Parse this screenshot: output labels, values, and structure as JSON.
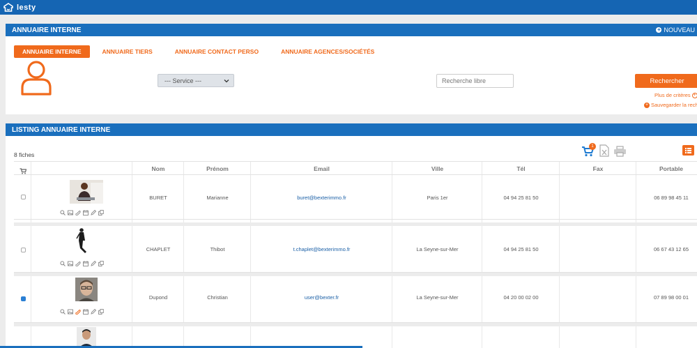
{
  "app": {
    "brand": "lesty"
  },
  "search_panel": {
    "title": "ANNUAIRE INTERNE",
    "new_label": "Nouveau",
    "tabs": [
      {
        "label": "ANNUAIRE INTERNE",
        "active": true
      },
      {
        "label": "ANNUAIRE TIERS",
        "active": false
      },
      {
        "label": "ANNUAIRE CONTACT PERSO",
        "active": false
      },
      {
        "label": "ANNUAIRE AGENCES/SOCIÉTÉS",
        "active": false
      }
    ],
    "service_value": "--- Service ---",
    "free_search_placeholder": "Recherche libre",
    "search_button": "Rechercher",
    "more_criteria": "Plus de critères",
    "save_search": "Sauvegarder la recher"
  },
  "list_panel": {
    "title": "LISTING ANNUAIRE INTERNE",
    "count": "8 fiches",
    "cart_badge": "1",
    "columns": [
      "Nom",
      "Prénom",
      "Email",
      "Ville",
      "Tél",
      "Fax",
      "Portable"
    ],
    "rows": [
      {
        "nom": "BURET",
        "prenom": "Marianne",
        "email": "buret@bexterimmo.fr",
        "ville": "Paris 1er",
        "tel": "04 94 25 81 50",
        "fax": "",
        "portable": "06 89 98 45 11",
        "checked": false
      },
      {
        "nom": "CHAPLET",
        "prenom": "Thibot",
        "email": "t.chaplet@bexterimmo.fr",
        "ville": "La Seyne-sur-Mer",
        "tel": "04 94 25 81 50",
        "fax": "",
        "portable": "06 67 43 12 65",
        "checked": false
      },
      {
        "nom": "Dupond",
        "prenom": "Christian",
        "email": "user@bexter.fr",
        "ville": "La Seyne-sur-Mer",
        "tel": "04 20 00 02 00",
        "fax": "",
        "portable": "07 89 98 00 01",
        "checked": true
      }
    ]
  },
  "colors": {
    "header_blue": "#1a6fbd",
    "accent_orange": "#f06a1c",
    "link_blue": "#1a5fa6"
  }
}
